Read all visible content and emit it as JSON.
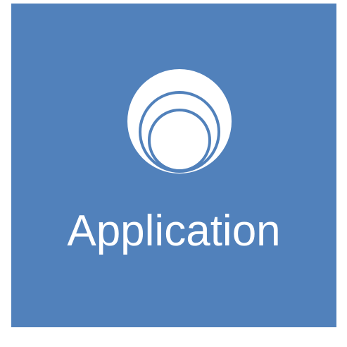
{
  "tile": {
    "label": "Application",
    "icon": "concentric-circles-icon",
    "background_color": "#5181bb",
    "foreground_color": "#ffffff"
  }
}
